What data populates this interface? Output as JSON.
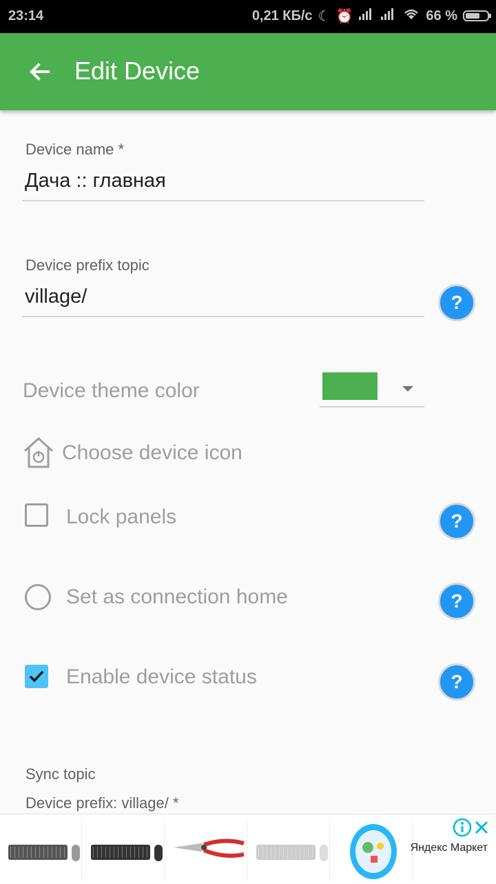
{
  "status_bar": {
    "time": "23:14",
    "network_speed": "0,21 КБ/с",
    "battery": "66 %",
    "battery_level": 0.66,
    "icons": [
      "moon-icon",
      "alarm-icon",
      "signal-icon",
      "signal-icon",
      "wifi-icon",
      "battery-icon"
    ]
  },
  "app_bar": {
    "title": "Edit Device",
    "back_icon": "arrow-left-icon",
    "color": "#4caf50"
  },
  "form": {
    "device_name": {
      "label": "Device name *",
      "value": "Дача :: главная"
    },
    "prefix_topic": {
      "label": "Device prefix topic",
      "value": "village/"
    },
    "theme_color": {
      "label": "Device theme color",
      "value": "#4caf50"
    },
    "icon_choice": {
      "label": "Choose device icon",
      "icon": "home-power-icon"
    },
    "lock_panels": {
      "label": "Lock panels",
      "checked": false
    },
    "connection_home": {
      "label": "Set as connection home",
      "selected": false
    },
    "device_status": {
      "label": "Enable device status",
      "checked": true
    },
    "sync_topic": {
      "label": "Sync topic",
      "prefix_label": "Device prefix: village/ *"
    },
    "help_icon": "question-icon"
  },
  "ad": {
    "brand": "Яндекс Маркет",
    "items": [
      "keyboard-mouse-set",
      "keyboard-mouse-set",
      "pruning-shears",
      "keyboard-mouse-set",
      "baby-toy"
    ]
  }
}
